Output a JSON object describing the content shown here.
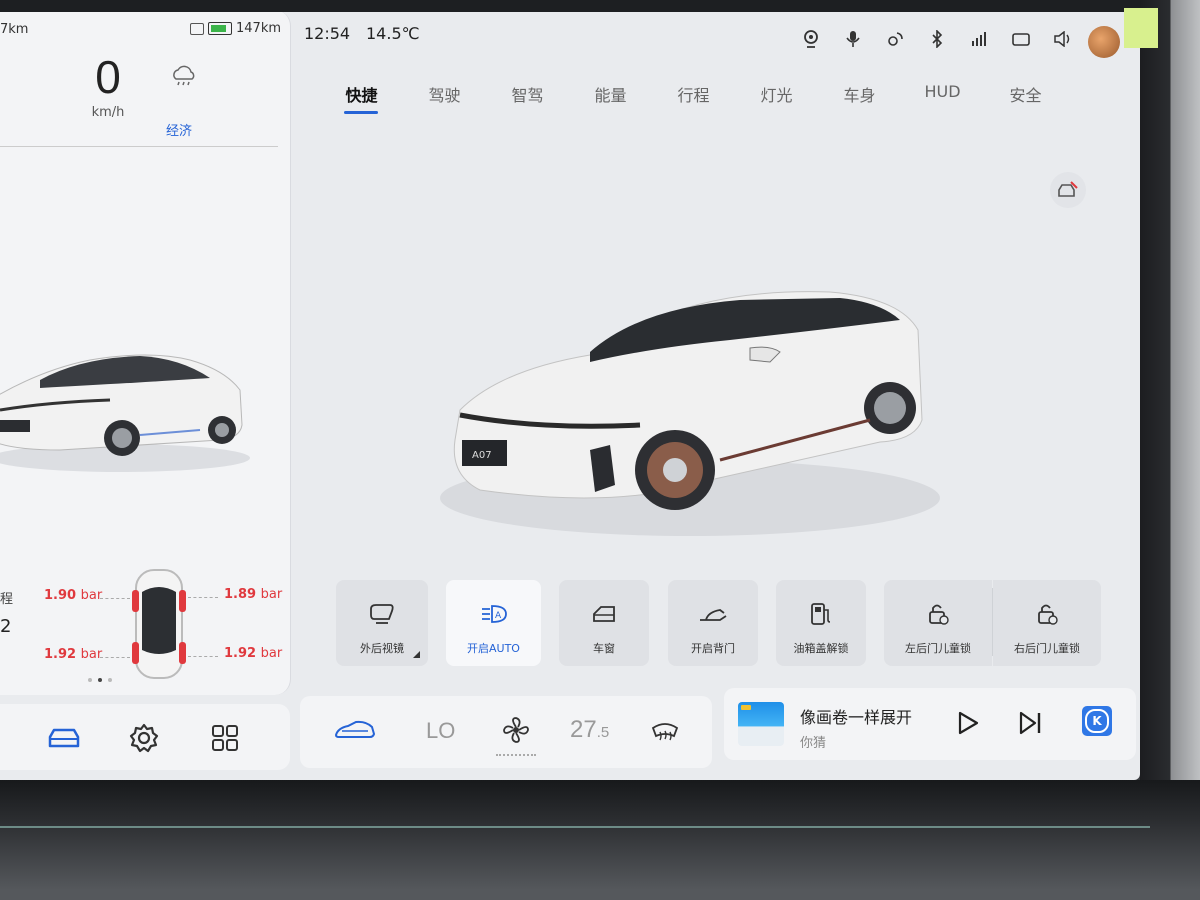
{
  "left_panel": {
    "range_text": "7km",
    "battery_range": "147km",
    "speed": "0",
    "speed_unit": "km/h",
    "drive_mode": "经济",
    "tire_label_left_top": "程",
    "tire_label_left_bottom": "2",
    "tire_pressure": {
      "front_left": "1.90",
      "front_right": "1.89",
      "rear_left": "1.92",
      "rear_right": "1.92",
      "unit": "bar"
    },
    "page_dots_active": 2
  },
  "status_bar": {
    "time": "12:54",
    "temperature": "14.5℃",
    "icons": [
      "camera-icon",
      "microphone-icon",
      "hotspot-icon",
      "bluetooth-icon",
      "signal-icon",
      "dashcam-icon",
      "volume-icon"
    ]
  },
  "tabs": [
    {
      "label": "快捷",
      "active": true
    },
    {
      "label": "驾驶",
      "active": false
    },
    {
      "label": "智驾",
      "active": false
    },
    {
      "label": "能量",
      "active": false
    },
    {
      "label": "行程",
      "active": false
    },
    {
      "label": "灯光",
      "active": false
    },
    {
      "label": "车身",
      "active": false
    },
    {
      "label": "HUD",
      "active": false
    },
    {
      "label": "安全",
      "active": false
    }
  ],
  "car": {
    "plate": "A07"
  },
  "quick_tiles": [
    {
      "label": "外后视镜",
      "icon": "mirror-icon"
    },
    {
      "label": "开启AUTO",
      "icon": "auto-headlight-icon",
      "active": true
    },
    {
      "label": "车窗",
      "icon": "window-icon"
    },
    {
      "label": "开启背门",
      "icon": "trunk-icon"
    },
    {
      "label": "油箱盖解锁",
      "icon": "fuel-cap-icon"
    },
    {
      "label": "左后门儿童锁",
      "icon": "child-lock-left-icon"
    },
    {
      "label": "右后门儿童锁",
      "icon": "child-lock-right-icon"
    }
  ],
  "climate": {
    "fan_level": "LO",
    "temperature_main": "27",
    "temperature_decimal": ".5"
  },
  "media": {
    "song_title": "像画卷一样展开",
    "artist": "你猜",
    "app_icon_letter": "K"
  },
  "colors": {
    "accent": "#2563d6",
    "warning": "#e0393e"
  }
}
